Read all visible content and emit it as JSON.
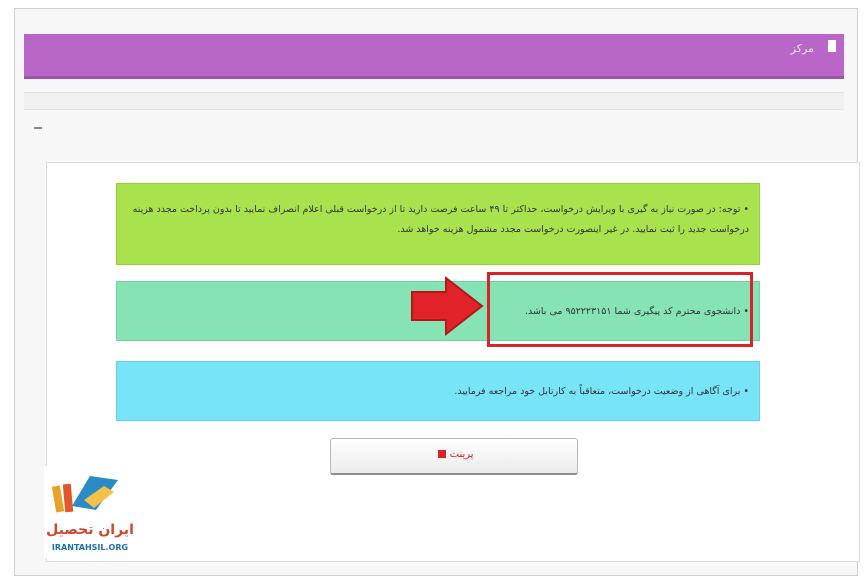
{
  "header": {
    "title": "مرکز"
  },
  "notices": [
    {
      "text": "• توجه: در صورت نیاز به گیری با ویرایش درخواست، حداکثر تا ۴۹ ساعت فرصت دارید تا از درخواست قبلی اعلام انصراف نمایید تا بدون پرداخت مجدد هزینه درخواست جدید را ثبت نمایید. در غیر اینصورت درخواست مجدد مشمول هزینه خواهد شد."
    },
    {
      "text": "• دانشجوی محترم کد پیگیری شما ۹۵۲۲۲۳۱۵۱ می باشد."
    },
    {
      "text": "• برای آگاهی از وضعیت درخواست، متعاقباً به کارتابل خود مراجعه فرمایید."
    }
  ],
  "pay_button": {
    "label": "پرینت"
  },
  "watermark": {
    "name": "ایران تحصیل",
    "url": "IRANTAHSIL.ORG"
  },
  "colors": {
    "header": "#b866c8",
    "notice_green": "#a8e24d",
    "notice_teal": "#86e3b3",
    "notice_cyan": "#78e4f8",
    "highlight": "#d8232a"
  }
}
